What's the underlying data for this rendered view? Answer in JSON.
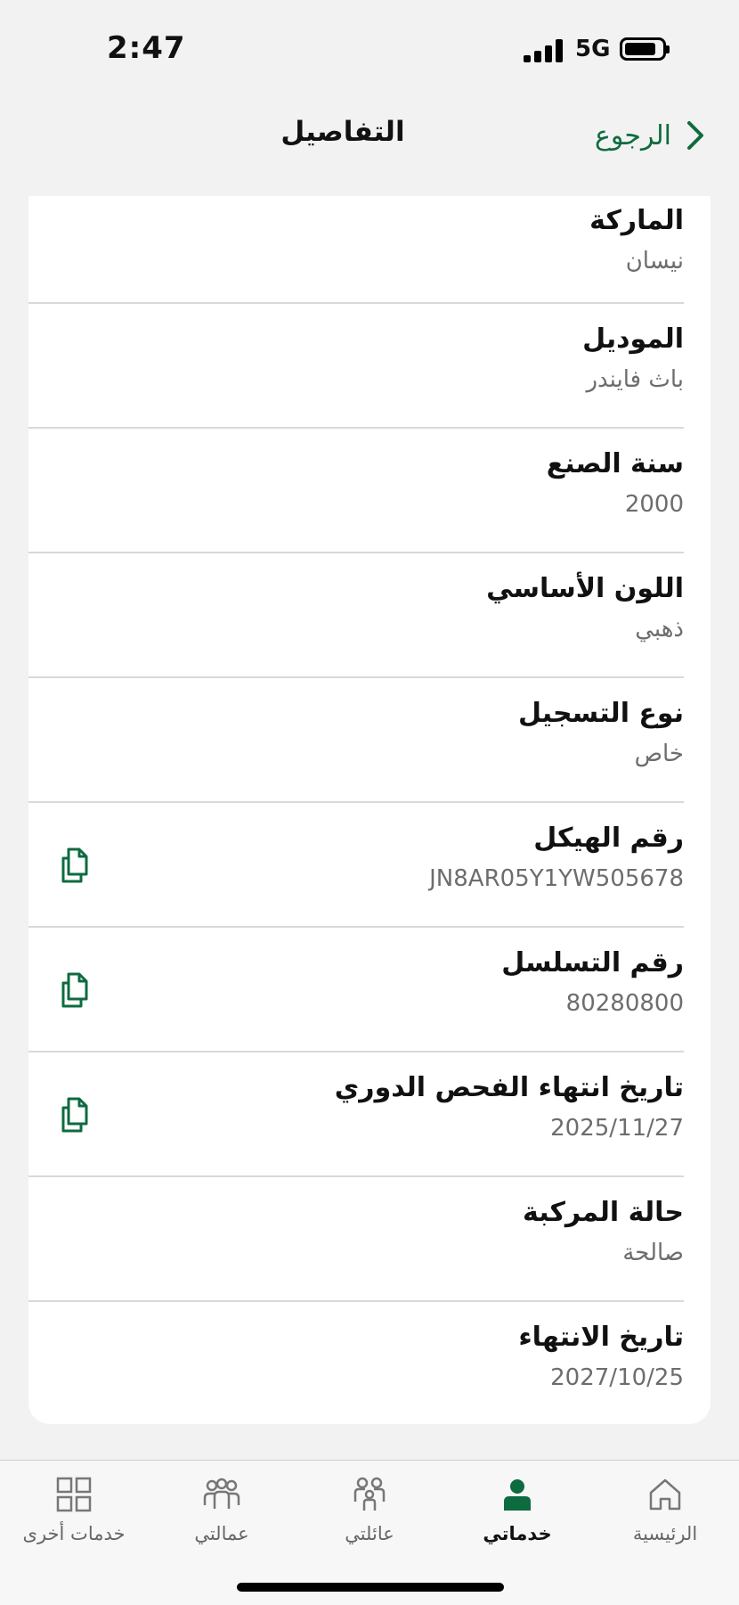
{
  "status_bar": {
    "time": "2:47",
    "network": "5G"
  },
  "header": {
    "title": "التفاصيل",
    "back_label": "الرجوع"
  },
  "details": [
    {
      "label": "الماركة",
      "value": "نيسان",
      "copyable": false
    },
    {
      "label": "الموديل",
      "value": "باث فايندر",
      "copyable": false
    },
    {
      "label": "سنة الصنع",
      "value": "2000",
      "copyable": false
    },
    {
      "label": "اللون الأساسي",
      "value": "ذهبي",
      "copyable": false
    },
    {
      "label": "نوع التسجيل",
      "value": "خاص",
      "copyable": false
    },
    {
      "label": "رقم الهيكل",
      "value": "JN8AR05Y1YW505678",
      "copyable": true
    },
    {
      "label": "رقم التسلسل",
      "value": "80280800",
      "copyable": true
    },
    {
      "label": "تاريخ انتهاء الفحص الدوري",
      "value": "2025/11/27",
      "copyable": true
    },
    {
      "label": "حالة المركبة",
      "value": "صالحة",
      "copyable": false
    },
    {
      "label": "تاريخ الانتهاء",
      "value": "2027/10/25",
      "copyable": false
    }
  ],
  "tabs": [
    {
      "label": "الرئيسية",
      "icon": "home-icon",
      "active": false
    },
    {
      "label": "خدماتي",
      "icon": "person-icon",
      "active": true
    },
    {
      "label": "عائلتي",
      "icon": "family-icon",
      "active": false
    },
    {
      "label": "عمالتي",
      "icon": "workers-icon",
      "active": false
    },
    {
      "label": "خدمات أخرى",
      "icon": "grid-icon",
      "active": false
    }
  ],
  "colors": {
    "accent": "#0e6b3f",
    "background": "#f2f2f2"
  }
}
